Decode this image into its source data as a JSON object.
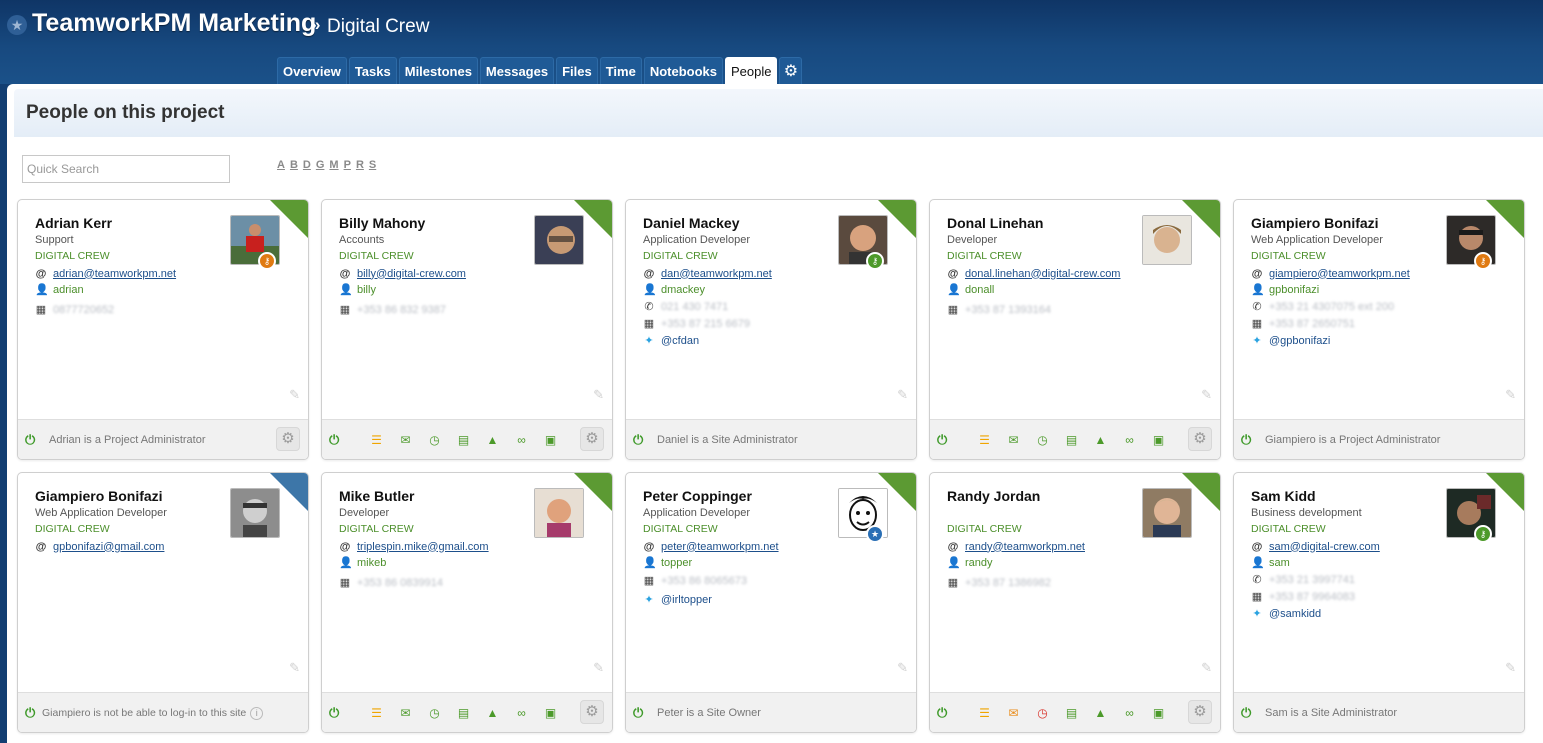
{
  "header": {
    "app_title": "TeamworkPM Marketing",
    "separator": "»",
    "project": "Digital Crew",
    "star_icon": "★"
  },
  "tabs": [
    {
      "label": "Overview",
      "active": false
    },
    {
      "label": "Tasks",
      "active": false
    },
    {
      "label": "Milestones",
      "active": false
    },
    {
      "label": "Messages",
      "active": false
    },
    {
      "label": "Files",
      "active": false
    },
    {
      "label": "Time",
      "active": false
    },
    {
      "label": "Notebooks",
      "active": false
    },
    {
      "label": "People",
      "active": true
    }
  ],
  "page": {
    "title": "People on this project",
    "search_placeholder": "Quick Search",
    "letters": [
      "A",
      "B",
      "D",
      "G",
      "M",
      "P",
      "R",
      "S"
    ]
  },
  "colors": {
    "header": "#17497f",
    "company_green": "#4c8f2b",
    "link_blue": "#1d4f8b",
    "corner_green": "#5c9a33",
    "corner_blue": "#3d76a8"
  },
  "people": [
    {
      "name": "Adrian Kerr",
      "title": "Support",
      "company": "DIGITAL CREW",
      "email": "adrian@teamworkpm.net",
      "username": "adrian",
      "mobile": "0877720652",
      "status": "Adrian is a Project Administrator",
      "avatar_icon": "person-red-jacket",
      "badge": "key-orange"
    },
    {
      "name": "Billy Mahony",
      "title": "Accounts",
      "company": "DIGITAL CREW",
      "email": "billy@digital-crew.com",
      "username": "billy",
      "mobile": "+353 86 832 9387"
    },
    {
      "name": "Daniel Mackey",
      "title": "Application Developer",
      "company": "DIGITAL CREW",
      "email": "dan@teamworkpm.net",
      "username": "dmackey",
      "phone": "021 430 7471",
      "mobile": "+353 87 215 6679",
      "twitter": "@cfdan",
      "status": "Daniel is a Site Administrator",
      "badge": "key-green"
    },
    {
      "name": "Donal Linehan",
      "title": "Developer",
      "company": "DIGITAL CREW",
      "email": "donal.linehan@digital-crew.com",
      "username": "donall",
      "mobile": "+353 87 1393164"
    },
    {
      "name": "Giampiero Bonifazi",
      "title": "Web Application Developer",
      "company": "DIGITAL CREW",
      "email": "giampiero@teamworkpm.net",
      "username": "gpbonifazi",
      "phone": "+353 21 4307075 ext 200",
      "mobile": "+353 87 2650751",
      "twitter": "@gpbonifazi",
      "status": "Giampiero is a Project Administrator",
      "badge": "key-orange"
    },
    {
      "name": "Giampiero Bonifazi",
      "title": "Web Application Developer",
      "company": "DIGITAL CREW",
      "email": "gpbonifazi@gmail.com",
      "status": "Giampiero is not be able to log-in to this site"
    },
    {
      "name": "Mike Butler",
      "title": "Developer",
      "company": "DIGITAL CREW",
      "email": "triplespin.mike@gmail.com",
      "username": "mikeb",
      "mobile": "+353 86 0839914"
    },
    {
      "name": "Peter Coppinger",
      "title": "Application Developer",
      "company": "DIGITAL CREW",
      "email": "peter@teamworkpm.net",
      "username": "topper",
      "mobile": "+353 86 8065673",
      "twitter": "@irltopper",
      "status": "Peter is a Site Owner",
      "badge": "star-blue"
    },
    {
      "name": "Randy Jordan",
      "title": "",
      "company": "DIGITAL CREW",
      "email": "randy@teamworkpm.net",
      "username": "randy",
      "mobile": "+353 87 1386982"
    },
    {
      "name": "Sam Kidd",
      "title": "Business development",
      "company": "DIGITAL CREW",
      "email": "sam@digital-crew.com",
      "username": "sam",
      "phone": "+353 21 3997741",
      "mobile": "+353 87 9964083",
      "twitter": "@samkidd",
      "status": "Sam is a Site Administrator",
      "badge": "key-green"
    }
  ]
}
